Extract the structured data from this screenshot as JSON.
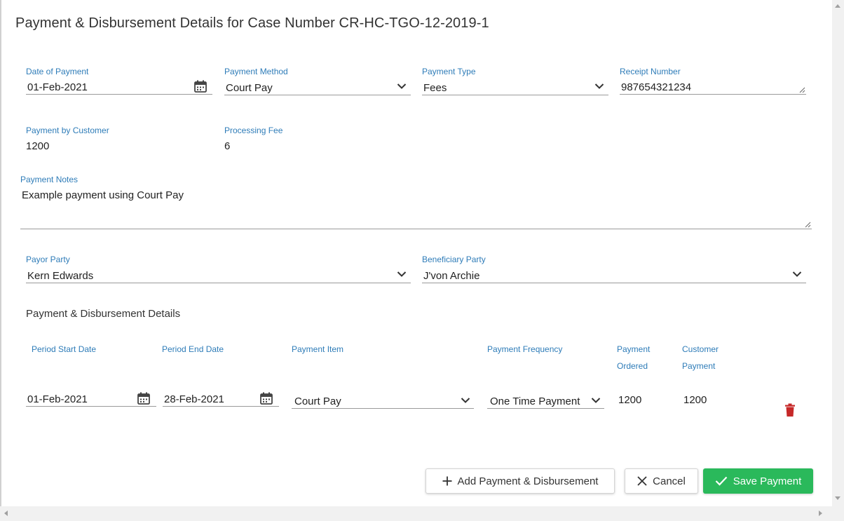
{
  "dialog": {
    "title": "Payment & Disbursement Details for Case Number CR-HC-TGO-12-2019-1"
  },
  "fields": {
    "date_of_payment": {
      "label": "Date of Payment",
      "value": "01-Feb-2021"
    },
    "payment_method": {
      "label": "Payment Method",
      "value": "Court Pay"
    },
    "payment_type": {
      "label": "Payment Type",
      "value": "Fees"
    },
    "receipt_number": {
      "label": "Receipt Number",
      "value": "987654321234"
    },
    "payment_by_customer": {
      "label": "Payment by Customer",
      "value": "1200"
    },
    "processing_fee": {
      "label": "Processing Fee",
      "value": "6"
    },
    "payment_notes": {
      "label": "Payment Notes",
      "value": "Example payment using Court Pay"
    },
    "payor_party": {
      "label": "Payor Party",
      "value": "Kern Edwards"
    },
    "beneficiary_party": {
      "label": "Beneficiary Party",
      "value": "J'von Archie"
    }
  },
  "details": {
    "section_title": "Payment & Disbursement Details",
    "headers": {
      "period_start": "Period Start Date",
      "period_end": "Period End Date",
      "payment_item": "Payment Item",
      "payment_frequency": "Payment Frequency",
      "payment_ordered_1": "Payment",
      "payment_ordered_2": "Ordered",
      "customer_payment_1": "Customer",
      "customer_payment_2": "Payment"
    },
    "rows": [
      {
        "period_start": "01-Feb-2021",
        "period_end": "28-Feb-2021",
        "payment_item": "Court Pay",
        "payment_frequency": "One Time Payment",
        "payment_ordered": "1200",
        "customer_payment": "1200"
      }
    ]
  },
  "buttons": {
    "add": "Add Payment & Disbursement",
    "cancel": "Cancel",
    "save": "Save Payment"
  },
  "colors": {
    "label": "#2e7cb8",
    "save_button": "#2ab95b",
    "delete_icon": "#c62828"
  },
  "icons": [
    "calendar-icon",
    "chevron-down-icon",
    "trash-icon",
    "plus-icon",
    "close-icon",
    "check-icon"
  ]
}
